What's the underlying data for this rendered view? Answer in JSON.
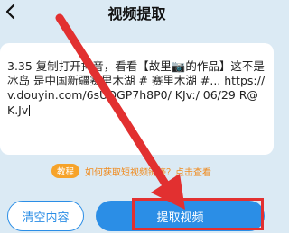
{
  "header": {
    "title": "视频提取",
    "back_icon": "chevron-left-icon"
  },
  "input": {
    "text": "3.35 复制打开抖音，看看【故里📷的作品】这不是冰岛 是中国新疆赛里木湖 # 赛里木湖 #... https://v.douyin.com/6sUOGP7h8P0/ KJv:/ 06/29 R@K.Jv"
  },
  "tip": {
    "badge": "教程",
    "text": "如何获取短视频链接？点击查看"
  },
  "buttons": {
    "clear_label": "清空内容",
    "extract_label": "提取视频"
  },
  "colors": {
    "accent": "#2b8ee6",
    "tip": "#f6a32a",
    "annotation": "#e23030",
    "background": "#dbeaf4"
  }
}
